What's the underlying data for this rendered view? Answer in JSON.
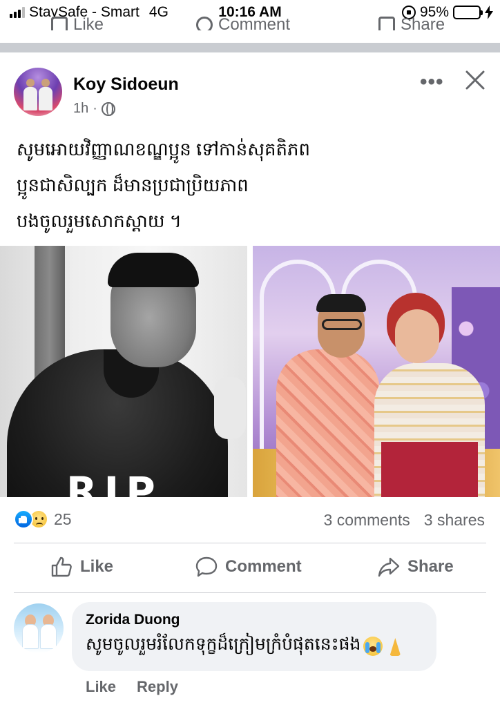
{
  "status_bar": {
    "carrier": "StaySafe - Smart",
    "network": "4G",
    "time": "10:16 AM",
    "battery_percent": "95%",
    "battery_level": 0.95,
    "battery_color": "#4cd964"
  },
  "prev_post_actions": {
    "like": "Like",
    "comment": "Comment",
    "share": "Share"
  },
  "post": {
    "author": "Koy Sidoeun",
    "time_ago": "1h",
    "separator": "·",
    "privacy_icon": "globe-icon",
    "more_icon": "more-icon",
    "close_icon": "close-icon",
    "text_lines": [
      "សូមអោយវិញ្ញាណខណ្ឌប្អូន ទៅកាន់សុគតិភព",
      "ប្អូនជាសិល្បក ដ៏មានប្រជាប្រិយភាព",
      "បងចូលរួមសោកស្តាយ ។"
    ],
    "photo_left_overlay": "RIP",
    "reaction_icons": [
      "like-icon",
      "sad-icon"
    ],
    "reaction_count": "25",
    "comments_count": "3 comments",
    "shares_count": "3 shares"
  },
  "actions": {
    "like": "Like",
    "comment": "Comment",
    "share": "Share"
  },
  "comment": {
    "author": "Zorida Duong",
    "text": "សូមចូលរួមរំលែកទុក្ខដ៏ក្រៀមក្រំបំផុតនេះផង",
    "emojis": [
      "crying-face-emoji",
      "folded-hands-emoji"
    ],
    "like": "Like",
    "reply": "Reply"
  },
  "colors": {
    "facebook_blue": "#0165e1",
    "secondary_text": "#65676b",
    "separator": "#c9ccd1"
  }
}
